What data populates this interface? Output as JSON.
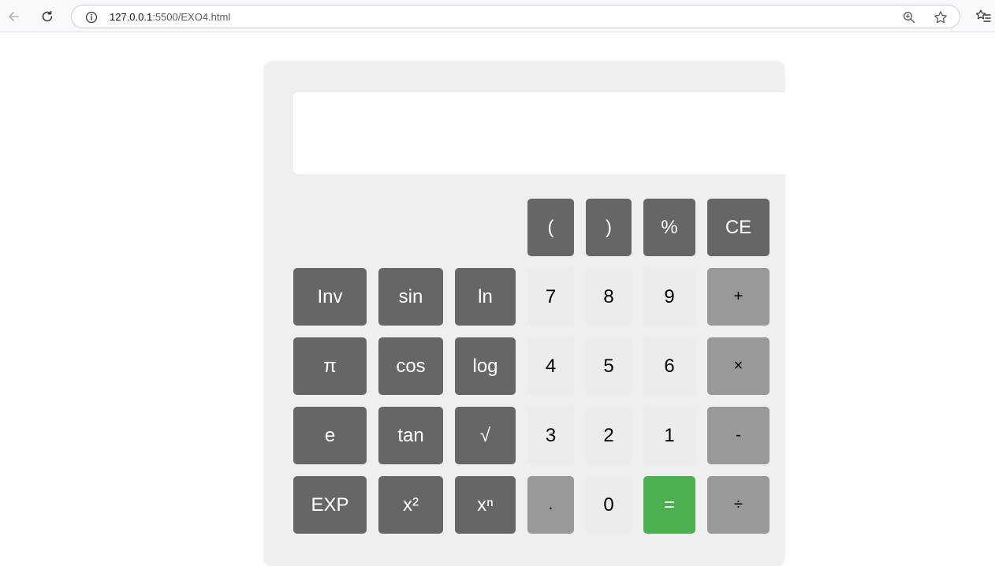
{
  "browser": {
    "url_host": "127.0.0.1",
    "url_rest": ":5500/EXO4.html"
  },
  "calculator": {
    "display_value": "",
    "row0": {
      "open_paren": "(",
      "close_paren": ")",
      "percent": "%",
      "clear": "CE"
    },
    "row1": {
      "inv": "Inv",
      "sin": "sin",
      "ln": "ln",
      "seven": "7",
      "eight": "8",
      "nine": "9",
      "plus": "+"
    },
    "row2": {
      "pi": "π",
      "cos": "cos",
      "log": "log",
      "four": "4",
      "five": "5",
      "six": "6",
      "multiply": "×"
    },
    "row3": {
      "e": "e",
      "tan": "tan",
      "sqrt": "√",
      "three": "3",
      "two": "2",
      "one": "1",
      "minus": "-"
    },
    "row4": {
      "exp": "EXP",
      "square": "x²",
      "power": "xⁿ",
      "dot": ".",
      "zero": "0",
      "equals": "=",
      "divide": "÷"
    }
  }
}
